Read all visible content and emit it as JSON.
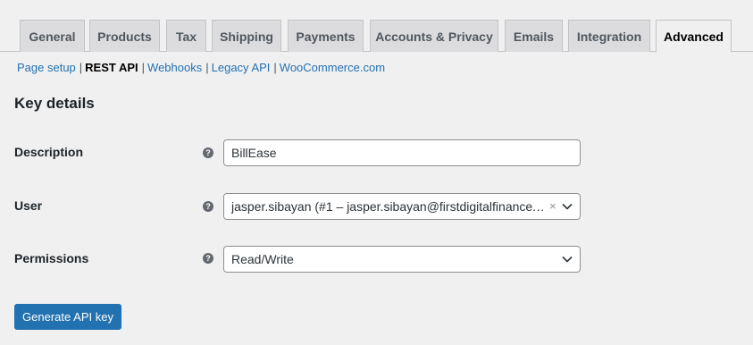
{
  "tabs": [
    "General",
    "Products",
    "Tax",
    "Shipping",
    "Payments",
    "Accounts & Privacy",
    "Emails",
    "Integration",
    "Advanced"
  ],
  "active_tab": "Advanced",
  "subnav": {
    "page_setup": "Page setup",
    "rest_api": "REST API",
    "webhooks": "Webhooks",
    "legacy_api": "Legacy API",
    "woocommerce": "WooCommerce.com",
    "separator": "|"
  },
  "section_title": "Key details",
  "form": {
    "description": {
      "label": "Description",
      "value": "BillEase"
    },
    "user": {
      "label": "User",
      "value": "jasper.sibayan (#1 – jasper.sibayan@firstdigitalfinance.…"
    },
    "permissions": {
      "label": "Permissions",
      "value": "Read/Write"
    },
    "help_glyph": "?",
    "clear_glyph": "×"
  },
  "generate_button": "Generate API key",
  "colors": {
    "accent": "#2271b1",
    "background": "#f0f0f1",
    "tab_inactive": "#dcdcde"
  }
}
